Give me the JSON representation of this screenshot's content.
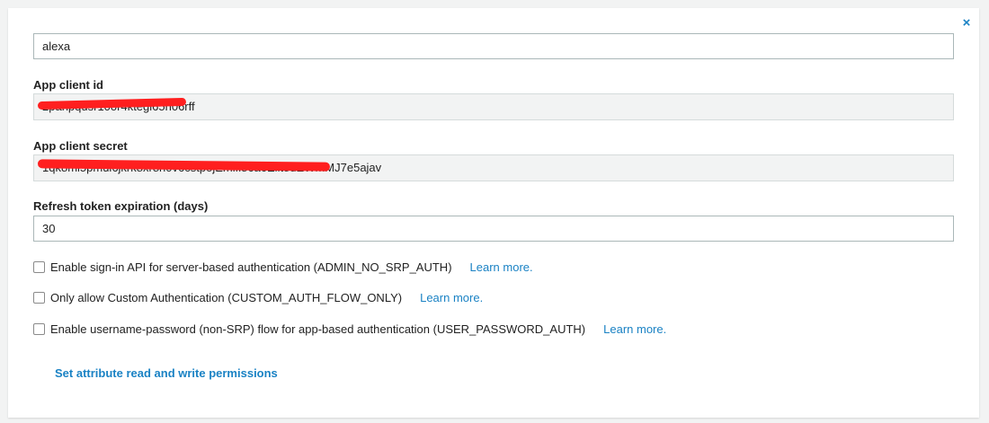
{
  "close_label": "×",
  "app_client_name": {
    "value": "alexa"
  },
  "app_client_id": {
    "label": "App client id",
    "value": "2panpqusr10or4ktegi65h06rff"
  },
  "app_client_secret": {
    "label": "App client secret",
    "value": "1qk8ml5pmul6jkrk8xr8n0v6cstpojEmifi86a6Elit8dEWmMJ7e5ajav"
  },
  "refresh_token": {
    "label": "Refresh token expiration (days)",
    "value": "30"
  },
  "options": [
    {
      "label": "Enable sign-in API for server-based authentication (ADMIN_NO_SRP_AUTH)",
      "link": "Learn more.",
      "checked": false
    },
    {
      "label": "Only allow Custom Authentication (CUSTOM_AUTH_FLOW_ONLY)",
      "link": "Learn more.",
      "checked": false
    },
    {
      "label": "Enable username-password (non-SRP) flow for app-based authentication (USER_PASSWORD_AUTH)",
      "link": "Learn more.",
      "checked": false
    }
  ],
  "attribute_permissions_link": "Set attribute read and write permissions",
  "colors": {
    "link": "#1a82c4",
    "redaction": "#ff1f1f",
    "readonly_bg": "#f2f3f3"
  }
}
